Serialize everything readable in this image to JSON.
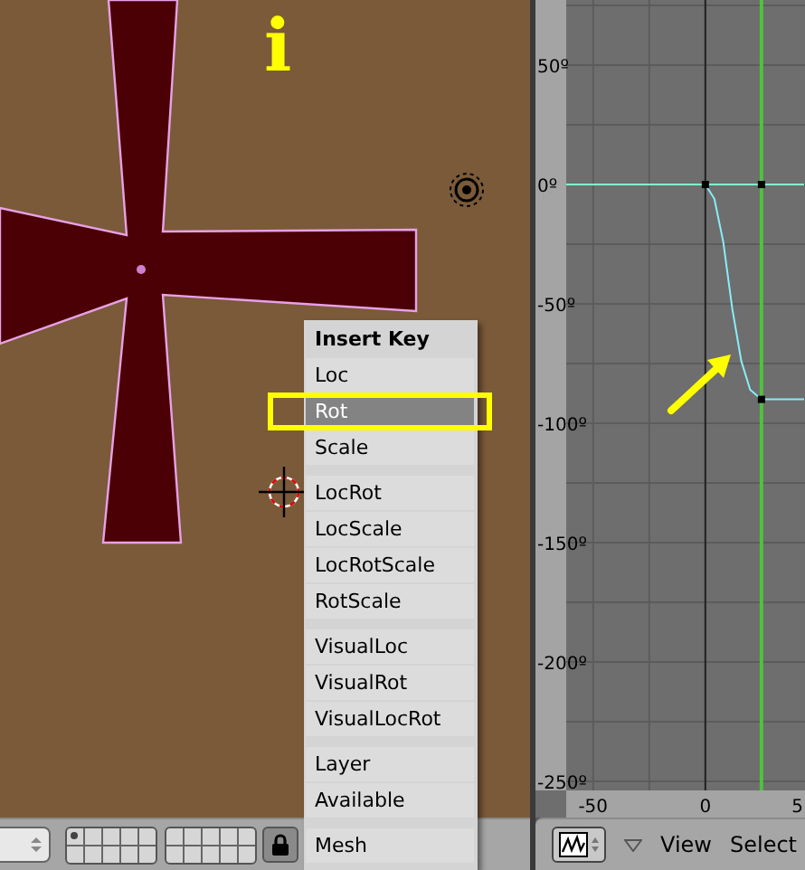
{
  "viewport": {
    "overlay_text": "i"
  },
  "insert_menu": {
    "title": "Insert Key",
    "groups": [
      [
        {
          "label": "Loc",
          "selected": false
        },
        {
          "label": "Rot",
          "selected": true
        },
        {
          "label": "Scale",
          "selected": false
        }
      ],
      [
        {
          "label": "LocRot",
          "selected": false
        },
        {
          "label": "LocScale",
          "selected": false
        },
        {
          "label": "LocRotScale",
          "selected": false
        },
        {
          "label": "RotScale",
          "selected": false
        }
      ],
      [
        {
          "label": "VisualLoc",
          "selected": false
        },
        {
          "label": "VisualRot",
          "selected": false
        },
        {
          "label": "VisualLocRot",
          "selected": false
        }
      ],
      [
        {
          "label": "Layer",
          "selected": false
        },
        {
          "label": "Available",
          "selected": false
        }
      ],
      [
        {
          "label": "Mesh",
          "selected": false
        }
      ]
    ]
  },
  "viewport_header": {
    "layers": [
      {
        "selected": true
      },
      {
        "selected": false
      },
      {
        "selected": false
      },
      {
        "selected": false
      },
      {
        "selected": false
      },
      {
        "selected": false
      },
      {
        "selected": false
      },
      {
        "selected": false
      },
      {
        "selected": false
      },
      {
        "selected": false
      },
      {
        "selected": false
      },
      {
        "selected": false
      },
      {
        "selected": false
      },
      {
        "selected": false
      },
      {
        "selected": false
      },
      {
        "selected": false
      },
      {
        "selected": false
      },
      {
        "selected": false
      },
      {
        "selected": false
      },
      {
        "selected": false
      }
    ],
    "locked": true
  },
  "graph": {
    "chart_data": {
      "type": "line",
      "x": [
        -62,
        0,
        4,
        8,
        12,
        16,
        20,
        25,
        44
      ],
      "series": [
        {
          "color": "#7fffd0",
          "values": [
            0,
            0,
            0,
            0,
            0,
            0,
            0,
            0,
            0
          ]
        },
        {
          "color": "#88eef8",
          "values": [
            null,
            0,
            -6,
            -24,
            -52,
            -74,
            -86,
            -90,
            -90
          ]
        }
      ],
      "xlim": [
        -62,
        44.4
      ],
      "ylim": [
        -253.8,
        77.3
      ],
      "grid": true,
      "xticks": [
        -50,
        0
      ],
      "yticks": [
        {
          "value": 50,
          "label": "50º"
        },
        {
          "value": 0,
          "label": "0º"
        },
        {
          "value": -50,
          "label": "-50º"
        },
        {
          "value": -100,
          "label": "-100º"
        },
        {
          "value": -150,
          "label": "-150º"
        },
        {
          "value": -200,
          "label": "-200º"
        },
        {
          "value": -250,
          "label": "-250º"
        }
      ],
      "ref_lines": [
        {
          "axis": "x",
          "value": 25,
          "color": "#50c040"
        }
      ]
    },
    "cut_tick_label": "5"
  },
  "graph_header": {
    "menus": [
      "View",
      "Select"
    ]
  }
}
